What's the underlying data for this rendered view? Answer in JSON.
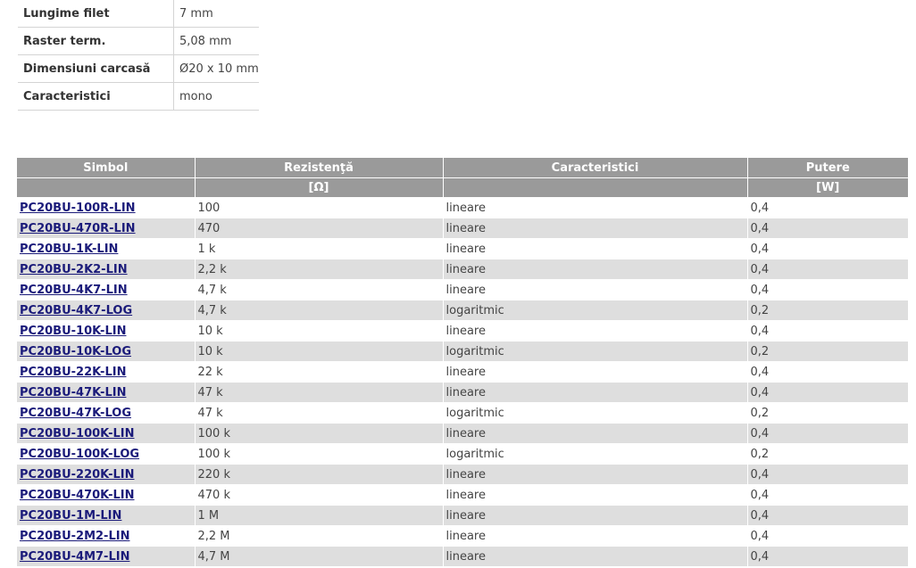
{
  "specs": [
    {
      "label": "Lungime filet",
      "value": "7 mm"
    },
    {
      "label": "Raster term.",
      "value": "5,08 mm"
    },
    {
      "label": "Dimensiuni carcasă",
      "value": "Ø20 x 10 mm"
    },
    {
      "label": "Caracteristici",
      "value": "mono"
    }
  ],
  "table": {
    "headers": [
      "Simbol",
      "Rezistenţă",
      "Caracteristici",
      "Putere"
    ],
    "units": [
      "",
      "[Ω]",
      "",
      "[W]"
    ],
    "rows": [
      {
        "symbol": "PC20BU-100R-LIN",
        "resistance": "100",
        "characteristic": "lineare",
        "power": "0,4"
      },
      {
        "symbol": "PC20BU-470R-LIN",
        "resistance": "470",
        "characteristic": "lineare",
        "power": "0,4"
      },
      {
        "symbol": "PC20BU-1K-LIN",
        "resistance": "1 k",
        "characteristic": "lineare",
        "power": "0,4"
      },
      {
        "symbol": "PC20BU-2K2-LIN",
        "resistance": "2,2 k",
        "characteristic": "lineare",
        "power": "0,4"
      },
      {
        "symbol": "PC20BU-4K7-LIN",
        "resistance": "4,7 k",
        "characteristic": "lineare",
        "power": "0,4"
      },
      {
        "symbol": "PC20BU-4K7-LOG",
        "resistance": "4,7 k",
        "characteristic": "logaritmic",
        "power": "0,2"
      },
      {
        "symbol": "PC20BU-10K-LIN",
        "resistance": "10 k",
        "characteristic": "lineare",
        "power": "0,4"
      },
      {
        "symbol": "PC20BU-10K-LOG",
        "resistance": "10 k",
        "characteristic": "logaritmic",
        "power": "0,2"
      },
      {
        "symbol": "PC20BU-22K-LIN",
        "resistance": "22 k",
        "characteristic": "lineare",
        "power": "0,4"
      },
      {
        "symbol": "PC20BU-47K-LIN",
        "resistance": "47 k",
        "characteristic": "lineare",
        "power": "0,4"
      },
      {
        "symbol": "PC20BU-47K-LOG",
        "resistance": "47 k",
        "characteristic": "logaritmic",
        "power": "0,2"
      },
      {
        "symbol": "PC20BU-100K-LIN",
        "resistance": "100 k",
        "characteristic": "lineare",
        "power": "0,4"
      },
      {
        "symbol": "PC20BU-100K-LOG",
        "resistance": "100 k",
        "characteristic": "logaritmic",
        "power": "0,2"
      },
      {
        "symbol": "PC20BU-220K-LIN",
        "resistance": "220 k",
        "characteristic": "lineare",
        "power": "0,4"
      },
      {
        "symbol": "PC20BU-470K-LIN",
        "resistance": "470 k",
        "characteristic": "lineare",
        "power": "0,4"
      },
      {
        "symbol": "PC20BU-1M-LIN",
        "resistance": "1 M",
        "characteristic": "lineare",
        "power": "0,4"
      },
      {
        "symbol": "PC20BU-2M2-LIN",
        "resistance": "2,2 M",
        "characteristic": "lineare",
        "power": "0,4"
      },
      {
        "symbol": "PC20BU-4M7-LIN",
        "resistance": "4,7 M",
        "characteristic": "lineare",
        "power": "0,4"
      }
    ]
  }
}
